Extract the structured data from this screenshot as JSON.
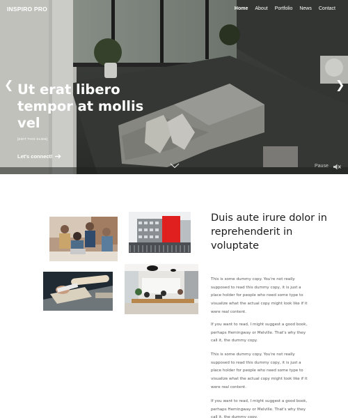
{
  "site": {
    "logo": "INSPIRO PRO"
  },
  "nav": {
    "items": [
      "Home",
      "About",
      "Portfolio",
      "News",
      "Contact"
    ],
    "active": "Home"
  },
  "hero": {
    "title": "Ut erat libero tempor at mollis vel",
    "edit_link": "[EDIT THIS SLIDE]",
    "cta": "Let's connect!",
    "pause_label": "Pause",
    "icons": {
      "prev": "chevron-left-icon",
      "next": "chevron-right-icon",
      "scroll": "chevron-down-icon",
      "mute": "speaker-muted-icon",
      "cta_arrow": "arrow-right-icon"
    }
  },
  "section": {
    "heading": "Duis aute irure dolor in reprehenderit in voluptate",
    "paragraphs": [
      "This is some dummy copy. You're not really supposed to read this dummy copy, it is just a place holder for people who need some type to visualize what the actual copy might look like if it were real content.",
      "If you want to read, I might suggest a good book, perhaps Hemingway or Melville. That's why they call it, the dummy copy.",
      "This is some dummy copy. You're not really supposed to read this dummy copy, it is just a place holder for people who need some type to visualize what the actual copy might look like if it were real content.",
      "If you want to read, I might suggest a good book, perhaps Hemingway or Melville. That's why they call it, the dummy copy."
    ]
  },
  "colors": {
    "text_dark": "#1a1a1a",
    "text_body": "#555555",
    "accent_red": "#e0201e"
  }
}
